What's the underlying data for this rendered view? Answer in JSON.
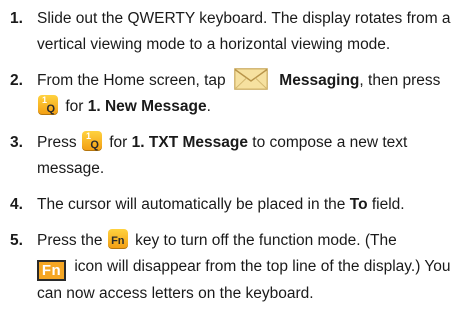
{
  "steps": [
    {
      "num": "1.",
      "text": "Slide out the QWERTY keyboard. The display rotates from a vertical viewing mode to a horizontal viewing mode."
    },
    {
      "num": "2.",
      "pre": "From the Home screen, tap",
      "icon": "envelope-icon",
      "bold1": "Messaging",
      "mid": ", then press",
      "key": {
        "sup": "1",
        "main": "Q"
      },
      "for": "for",
      "bold2": "1. New Message",
      "end": "."
    },
    {
      "num": "3.",
      "pre": "Press",
      "key": {
        "sup": "1",
        "main": "Q"
      },
      "for": "for",
      "bold": "1. TXT Message",
      "post": "to compose a new text message."
    },
    {
      "num": "4.",
      "pre": "The cursor will automatically be placed in the",
      "bold": "To",
      "post": "field."
    },
    {
      "num": "5.",
      "pre": "Press the",
      "key": {
        "main": "Fn"
      },
      "post1": "key to turn off the function mode. (The",
      "badge": "Fn",
      "post2": "icon will disappear from the top line of the display.) You can now access letters on the keyboard."
    }
  ],
  "colors": {
    "key_orange": "#f5a623",
    "envelope_fill": "#f6e1a0",
    "text": "#1a1a1a"
  }
}
